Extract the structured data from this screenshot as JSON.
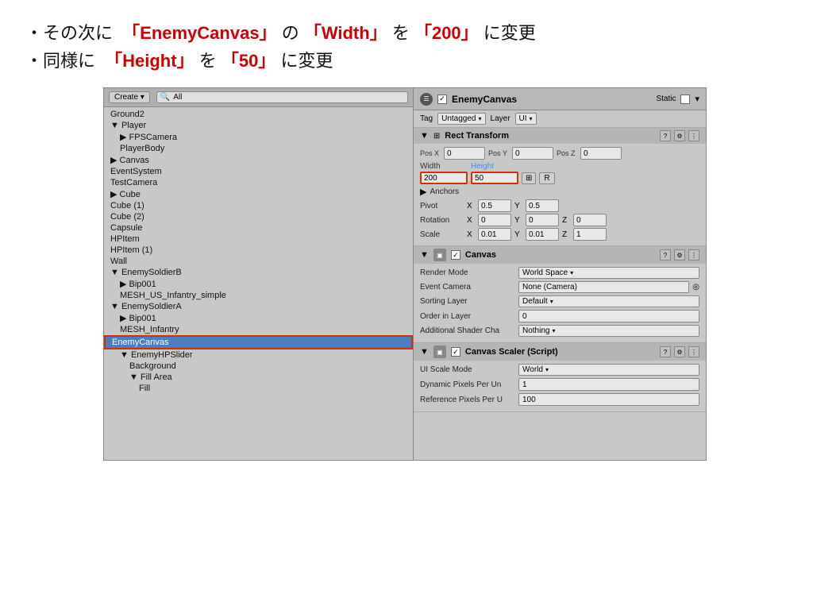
{
  "instructions": {
    "line1": {
      "prefix": "・その次に",
      "item1": "「EnemyCanvas」",
      "middle1": " の ",
      "item2": "「Width」",
      "middle2": " を ",
      "item3": "「200」",
      "suffix": " に変更"
    },
    "line2": {
      "prefix": "・同様に ",
      "item1": "「Height」",
      "middle1": " を ",
      "item2": "「50」",
      "suffix": " に変更"
    }
  },
  "toolbar": {
    "create_btn": "Create ▾",
    "search_placeholder": "Q▾All"
  },
  "hierarchy": {
    "items": [
      {
        "label": "Ground2",
        "indent": 0,
        "expanded": false
      },
      {
        "label": "▼ Player",
        "indent": 0,
        "expanded": true
      },
      {
        "label": "▶ FPSCamera",
        "indent": 1,
        "expanded": false
      },
      {
        "label": "PlayerBody",
        "indent": 1,
        "expanded": false
      },
      {
        "label": "▶ Canvas",
        "indent": 0,
        "expanded": false
      },
      {
        "label": "EventSystem",
        "indent": 0,
        "expanded": false
      },
      {
        "label": "TestCamera",
        "indent": 0,
        "expanded": false
      },
      {
        "label": "▶ Cube",
        "indent": 0,
        "expanded": false
      },
      {
        "label": "Cube (1)",
        "indent": 0,
        "expanded": false
      },
      {
        "label": "Cube (2)",
        "indent": 0,
        "expanded": false
      },
      {
        "label": "Capsule",
        "indent": 0,
        "expanded": false
      },
      {
        "label": "HPItem",
        "indent": 0,
        "expanded": false
      },
      {
        "label": "HPItem (1)",
        "indent": 0,
        "expanded": false
      },
      {
        "label": "Wall",
        "indent": 0,
        "expanded": false
      },
      {
        "label": "▼ EnemySoldierB",
        "indent": 0,
        "expanded": true
      },
      {
        "label": "▶ Bip001",
        "indent": 1,
        "expanded": false
      },
      {
        "label": "MESH_US_Infantry_simple",
        "indent": 1,
        "expanded": false
      },
      {
        "label": "▼ EnemySoldierA",
        "indent": 0,
        "expanded": true
      },
      {
        "label": "▶ Bip001",
        "indent": 1,
        "expanded": false
      },
      {
        "label": "MESH_Infantry",
        "indent": 1,
        "expanded": false
      },
      {
        "label": "EnemyCanvas",
        "indent": 0,
        "selected": true
      },
      {
        "label": "▼ EnemyHPSlider",
        "indent": 1,
        "expanded": true
      },
      {
        "label": "Background",
        "indent": 2,
        "expanded": false
      },
      {
        "label": "▼ Fill Area",
        "indent": 2,
        "expanded": true
      },
      {
        "label": "Fill",
        "indent": 3,
        "expanded": false
      }
    ]
  },
  "inspector": {
    "object_name": "EnemyCanvas",
    "static_label": "Static",
    "tag_label": "Tag",
    "tag_value": "Untagged",
    "layer_label": "Layer",
    "layer_value": "UI",
    "rect_transform": {
      "title": "Rect Transform",
      "pos_x_label": "Pos X",
      "pos_y_label": "Pos Y",
      "pos_z_label": "Pos Z",
      "pos_x_value": "0",
      "pos_y_value": "0",
      "pos_z_value": "0",
      "width_label": "Width",
      "height_label": "Height",
      "width_value": "200",
      "height_value": "50",
      "anchors_label": "Anchors",
      "pivot_label": "Pivot",
      "pivot_x": "0.5",
      "pivot_y": "0.5",
      "rotation_label": "Rotation",
      "rot_x": "0",
      "rot_y": "0",
      "rot_z": "0",
      "scale_label": "Scale",
      "scale_x": "0.01",
      "scale_y": "0.01",
      "scale_z": "1"
    },
    "canvas": {
      "title": "Canvas",
      "render_mode_label": "Render Mode",
      "render_mode_value": "World Space",
      "event_camera_label": "Event Camera",
      "event_camera_value": "None (Camera)",
      "sorting_layer_label": "Sorting Layer",
      "sorting_layer_value": "Default",
      "order_in_layer_label": "Order in Layer",
      "order_in_layer_value": "0",
      "additional_shader_label": "Additional Shader Cha",
      "additional_shader_value": "Nothing"
    },
    "canvas_scaler": {
      "title": "Canvas Scaler (Script)",
      "ui_scale_label": "UI Scale Mode",
      "ui_scale_value": "World",
      "dynamic_pixels_label": "Dynamic Pixels Per Un",
      "dynamic_pixels_value": "1",
      "reference_pixels_label": "Reference Pixels Per U",
      "reference_pixels_value": "100"
    }
  }
}
